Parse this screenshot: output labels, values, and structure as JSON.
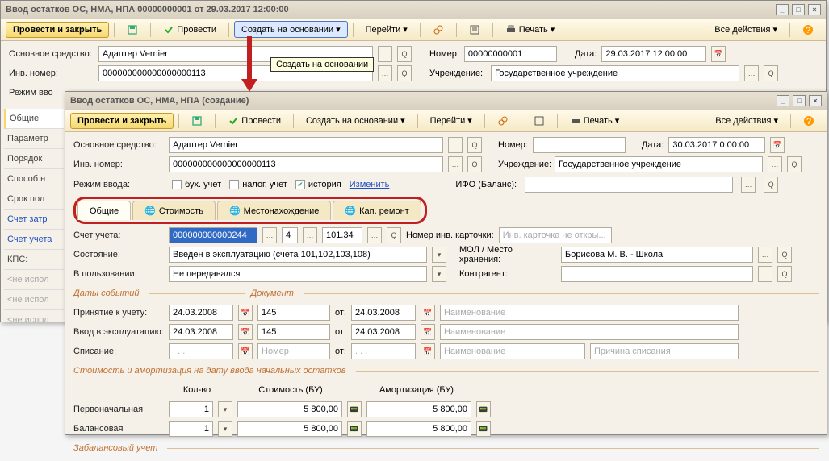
{
  "w1": {
    "title": "Ввод остатков ОС, НМА, НПА 00000000001 от 29.03.2017 12:00:00",
    "toolbar": {
      "post_close": "Провести и закрыть",
      "post": "Провести",
      "create_based": "Создать на основании",
      "go": "Перейти",
      "print": "Печать",
      "all_actions": "Все действия"
    },
    "tooltip": "Создать на основании",
    "fields": {
      "main_asset_lbl": "Основное средство:",
      "main_asset_val": "Адаптер Vernier",
      "inv_lbl": "Инв. номер:",
      "inv_val": "000000000000000000113",
      "number_lbl": "Номер:",
      "number_val": "00000000001",
      "date_lbl": "Дата:",
      "date_val": "29.03.2017 12:00:00",
      "org_lbl": "Учреждение:",
      "org_val": "Государственное учреждение",
      "mode_lbl": "Режим вво"
    },
    "sidetabs": [
      "Общие",
      "Параметр",
      "Порядок",
      "Способ н",
      "Срок пол",
      "Счет затр",
      "Счет учета",
      "КПС:",
      "<не испол",
      "<не испол",
      "<не испол"
    ]
  },
  "w2": {
    "title": "Ввод остатков ОС, НМА, НПА (создание)",
    "toolbar": {
      "post_close": "Провести и закрыть",
      "post": "Провести",
      "create_based": "Создать на основании",
      "go": "Перейти",
      "print": "Печать",
      "all_actions": "Все действия"
    },
    "fields": {
      "main_asset_lbl": "Основное средство:",
      "main_asset_val": "Адаптер Vernier",
      "number_lbl": "Номер:",
      "number_val": "",
      "date_lbl": "Дата:",
      "date_val": "30.03.2017 0:00:00",
      "inv_lbl": "Инв. номер:",
      "inv_val": "000000000000000000113",
      "org_lbl": "Учреждение:",
      "org_val": "Государственное учреждение",
      "mode_lbl": "Режим ввода:",
      "mode_buh": "бух. учет",
      "mode_nalog": "налог. учет",
      "mode_hist": "история",
      "mode_edit": "Изменить",
      "ifo_lbl": "ИФО (Баланс):",
      "acct_lbl": "Счет учета:",
      "acct_val": "000000000000244",
      "acct_sub1": "4",
      "acct_sub2": "101.34",
      "card_lbl": "Номер инв. карточки:",
      "card_ph": "Инв. карточка не откры...",
      "state_lbl": "Состояние:",
      "state_val": "Введен в эксплуатацию (счета 101,102,103,108)",
      "mol_lbl": "МОЛ / Место хранения:",
      "mol_val": "Борисова М. В. - Школа",
      "use_lbl": "В пользовании:",
      "use_val": "Не передавался",
      "contr_lbl": "Контрагент:",
      "dates_section": "Даты событий",
      "doc_section": "Документ",
      "accept_lbl": "Принятие к учету:",
      "accept_date": "24.03.2008",
      "accept_num": "145",
      "accept_from_lbl": "от:",
      "accept_from": "24.03.2008",
      "name_ph": "Наименование",
      "commiss_lbl": "Ввод в эксплуатацию:",
      "commiss_date": "24.03.2008",
      "commiss_num": "145",
      "commiss_from": "24.03.2008",
      "writeoff_lbl": "Списание:",
      "num_ph": "Номер",
      "reason_ph": "Причина списания",
      "cost_section": "Стоимость и амортизация на дату ввода начальных остатков",
      "qty_col": "Кол-во",
      "cost_col": "Стоимость (БУ)",
      "amort_col": "Амортизация (БУ)",
      "initial_lbl": "Первоначальная",
      "initial_qty": "1",
      "initial_cost": "5 800,00",
      "initial_amort": "5 800,00",
      "balance_lbl": "Балансовая",
      "balance_qty": "1",
      "balance_cost": "5 800,00",
      "balance_amort": "5 800,00",
      "offbal_lbl": "Забалансовый учет"
    },
    "tabs": [
      "Общие",
      "Стоимость",
      "Местонахождение",
      "Кап. ремонт"
    ]
  }
}
